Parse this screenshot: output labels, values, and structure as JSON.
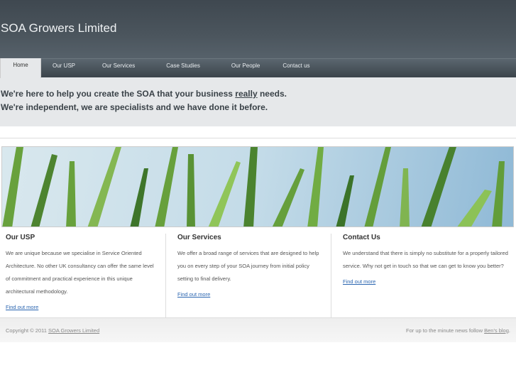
{
  "header": {
    "title": "SOA Growers Limited"
  },
  "nav": [
    "Home",
    "Our USP",
    "Our Services",
    "Case Studies",
    "Our People",
    "Contact us"
  ],
  "intro": {
    "line1_before": "We're here to help you create the SOA that your business ",
    "line1_emph": "really",
    "line1_after": " needs.",
    "line2": "We're independent, we are specialists and we have done it before."
  },
  "columns": [
    {
      "title": "Our USP",
      "text": "We are unique because we specialise in Service Oriented Architecture. No other UK consultancy can offer the same level of commitment and practical experience in this unique architectural methodology.",
      "link": "Find out more"
    },
    {
      "title": "Our Services",
      "text": "We offer a broad range of services that are designed to help you on every step of your SOA journey from initial policy setting to final delivery.",
      "link": "Find out more"
    },
    {
      "title": "Contact Us",
      "text": "We understand that there is simply no substitute for a properly tailored service. Why not get in touch so that we can get to know you better?",
      "link": "Find out more"
    }
  ],
  "footer": {
    "copyright": "Copyright © 2011",
    "company_link": "SOA Growers Limited",
    "news_text": "For up to the minute news follow",
    "blog_link": "Ben's blog",
    "period": "."
  }
}
